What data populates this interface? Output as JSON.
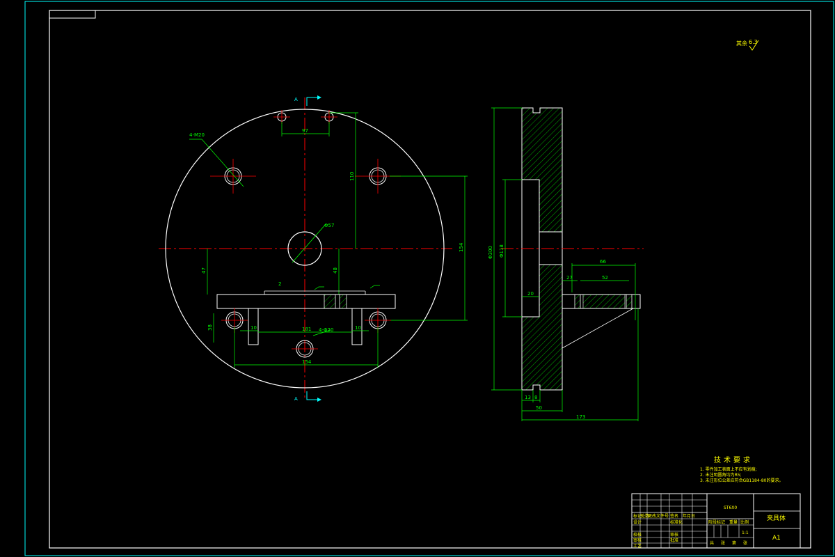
{
  "colors": {
    "background": "#000000",
    "frame": "#00ffff",
    "outline": "#ffffff",
    "dimension": "#00ff00",
    "centerline": "#ff0000",
    "text": "#ffff00"
  },
  "section_marks": {
    "top": "A",
    "bottom": "A"
  },
  "roughness": {
    "note": "其余",
    "value": "6.3"
  },
  "front_view": {
    "dims": {
      "hole_m20": "4-M20",
      "pitch_97": "97",
      "height_110": "110",
      "center_hole": "Φ57",
      "overall_154": "154",
      "left_47": "47",
      "mid_48": "48",
      "angle_2": "2",
      "depth_38": "38",
      "gap_10a": "10",
      "span_181": "181",
      "holes_phi": "4-Φ20",
      "gap_10b": "10",
      "bottom_154": "154"
    }
  },
  "side_view": {
    "dims": {
      "overall_d": "Φ300",
      "bore_d": "Φ118",
      "step_20": "20",
      "len_66": "66",
      "len_27": "27",
      "len_52": "52",
      "base_13": "13",
      "base_8": "8",
      "base_50": "50",
      "total_173": "173"
    }
  },
  "tech_requirements": {
    "title": "技术要求",
    "items": [
      "1. 零件加工表面上不应有划痕;",
      "2. 未注明圆角均为R5;",
      "3. 未注形位公差应符合GB1184-80的要求。"
    ]
  },
  "title_block": {
    "drawing_no": "ST6X0",
    "part_name": "夹具体",
    "sheet_size": "A1",
    "scale": "1:1",
    "material_label": "",
    "header_cells": [
      "标记",
      "处数",
      "更改文件号",
      "签名",
      "年月日"
    ],
    "left_labels": [
      "设计",
      "校核",
      "审核",
      "工艺"
    ],
    "mid_labels": [
      "标准化",
      "审核",
      "批准"
    ],
    "stage_labels": [
      "阶段标记",
      "重量",
      "比例"
    ],
    "bottom_labels": [
      "共",
      "张",
      "第",
      "张"
    ]
  }
}
